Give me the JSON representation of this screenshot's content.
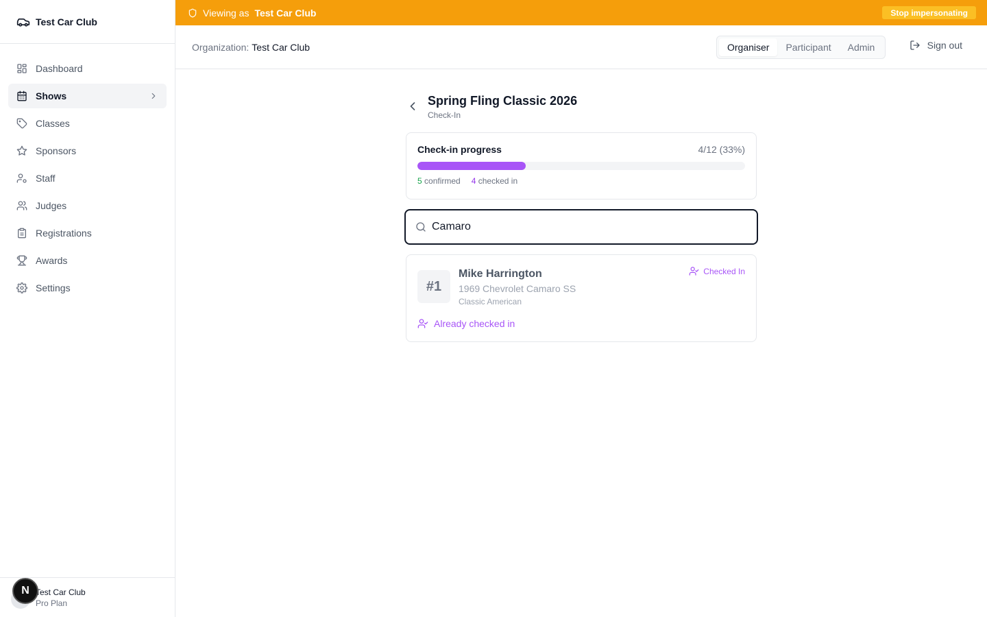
{
  "sidebar": {
    "brand": "Test Car Club",
    "items": [
      {
        "label": "Dashboard"
      },
      {
        "label": "Shows"
      },
      {
        "label": "Classes"
      },
      {
        "label": "Sponsors"
      },
      {
        "label": "Staff"
      },
      {
        "label": "Judges"
      },
      {
        "label": "Registrations"
      },
      {
        "label": "Awards"
      },
      {
        "label": "Settings"
      }
    ],
    "footer": {
      "name": "Test Car Club",
      "plan": "Pro Plan",
      "badge": "N"
    }
  },
  "banner": {
    "prefix": "Viewing as",
    "org": "Test Car Club",
    "stop_label": "Stop impersonating",
    "color": "#f59e0b"
  },
  "header": {
    "org_label": "Organization:",
    "org_name": "Test Car Club",
    "roles": [
      "Organiser",
      "Participant",
      "Admin"
    ],
    "active_role": "Organiser",
    "signout_label": "Sign out"
  },
  "page": {
    "title": "Spring Fling Classic 2026",
    "subtitle": "Check-In"
  },
  "progress": {
    "title": "Check-in progress",
    "count_text": "4/12 (33%)",
    "fraction": 0.33,
    "confirmed_count": "5",
    "confirmed_label": "confirmed",
    "checked_count": "4",
    "checked_label": "checked in",
    "accent": "#a855f7"
  },
  "search": {
    "value": "Camaro"
  },
  "results": [
    {
      "number": "#1",
      "name": "Mike Harrington",
      "car": "1969 Chevrolet Camaro SS",
      "class": "Classic American",
      "status": "Checked In",
      "action": "Already checked in"
    }
  ]
}
